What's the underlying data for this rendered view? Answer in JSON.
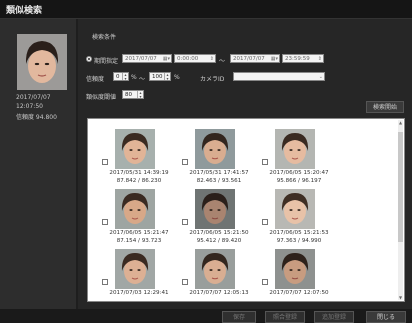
{
  "window": {
    "title": "類似検索"
  },
  "query": {
    "date": "2017/07/07",
    "time": "12:07:50",
    "score": "信頼度 94.800"
  },
  "conditions": {
    "section_label": "検索条件",
    "period_label": "期間指定",
    "from_date": "2017/07/07",
    "from_time": "0:00:00",
    "tilde": "～",
    "to_date": "2017/07/07",
    "to_time": "23:59:59",
    "confidence_label": "信頼度",
    "conf_min": "0",
    "conf_min_unit": "%",
    "conf_tilde": "～",
    "conf_max": "100",
    "conf_max_unit": "%",
    "camera_label": "カメラID",
    "camera_value": "",
    "similarity_label": "類似度閾値",
    "similarity_value": "80",
    "search_button": "検索開始"
  },
  "results": [
    {
      "date": "2017/05/31 14:39:19",
      "score": "87.842 / 86.230"
    },
    {
      "date": "2017/05/31 17:41:57",
      "score": "82.463 / 93.561"
    },
    {
      "date": "2017/06/05 15:20:47",
      "score": "95.866 / 96.197"
    },
    {
      "date": "2017/06/05 15:21:47",
      "score": "87.154 / 93.723"
    },
    {
      "date": "2017/06/05 15:21:50",
      "score": "95.412 / 89.420"
    },
    {
      "date": "2017/06/05 15:21:53",
      "score": "97.363 / 94.990"
    },
    {
      "date": "2017/07/03 12:29:41",
      "score": ""
    },
    {
      "date": "2017/07/07 12:05:13",
      "score": ""
    },
    {
      "date": "2017/07/07 12:07:50",
      "score": ""
    }
  ],
  "footer": {
    "save": "保存",
    "compare": "照合登録",
    "register": "追加登録",
    "close": "閉じる"
  }
}
